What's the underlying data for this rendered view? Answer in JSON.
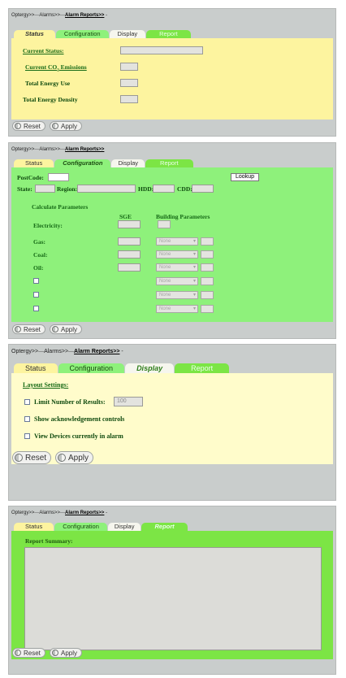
{
  "breadcrumb": {
    "item1": "Optergy>>",
    "item2": "Alarms>>",
    "current": "Alarm Reports>>",
    "tail": " -"
  },
  "tabs": {
    "status": "Status",
    "configuration": "Configuration",
    "display": "Display",
    "report": "Report"
  },
  "buttons": {
    "reset": "Reset",
    "apply": "Apply"
  },
  "status_panel": {
    "current_status": "Current Status:",
    "current_co2_prefix": "Current CO",
    "current_co2_sub": "2",
    "current_co2_suffix": " Emissions",
    "total_energy_use": "Total Energy Use",
    "total_energy_density": "Total Energy Density"
  },
  "configuration_panel": {
    "postcode": "PostCode:",
    "lookup": "Lookup",
    "state": "State:",
    "region": "Region:",
    "hdd": "HDD:",
    "cdd": "CDD:",
    "calculate_parameters": "Calculate Parameters",
    "sge": "SGE",
    "building_parameters": "Building Parameters",
    "electricity": "Electricity:",
    "gas": "Gas:",
    "coal": "Coal:",
    "oil": "Oil:",
    "select_none": "None"
  },
  "display_panel": {
    "layout_settings": "Layout Settings:",
    "limit_results": "Limit Number of Results:",
    "limit_value": "100",
    "show_ack": "Show acknowledgement controls",
    "view_devices": "View Devices currently in alarm"
  },
  "report_panel": {
    "report_summary": "Report Summary:"
  }
}
